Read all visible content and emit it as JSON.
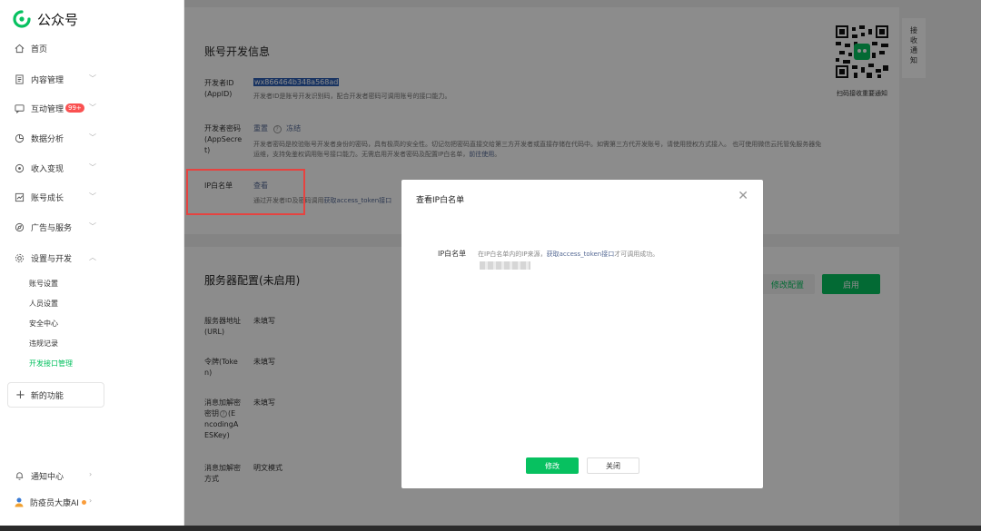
{
  "app": {
    "title": "公众号",
    "brand_color": "#07c160"
  },
  "sidebar": {
    "items": [
      {
        "label": "首页",
        "icon": "home-icon"
      },
      {
        "label": "内容管理",
        "icon": "document-icon"
      },
      {
        "label": "互动管理",
        "icon": "message-icon",
        "badge": "99+"
      },
      {
        "label": "数据分析",
        "icon": "chart-icon"
      },
      {
        "label": "收入变现",
        "icon": "coin-icon"
      },
      {
        "label": "账号成长",
        "icon": "growth-icon"
      },
      {
        "label": "广告与服务",
        "icon": "compass-icon"
      },
      {
        "label": "设置与开发",
        "icon": "gear-icon"
      }
    ],
    "sub_items": [
      "账号设置",
      "人员设置",
      "安全中心",
      "违规记录",
      "开发接口管理"
    ],
    "new_func": "新的功能",
    "notify": "通知中心",
    "user": "防疫员大康AI"
  },
  "dev_info": {
    "title": "账号开发信息",
    "appid_label1": "开发者ID",
    "appid_label2": "(AppID)",
    "appid_value": "wx866464b348a568ad",
    "appid_desc": "开发者ID是账号开发识别码，配合开发者密码可调用账号的接口能力。",
    "secret_label1": "开发者密码",
    "secret_label2": "(AppSecre",
    "secret_label3": "t)",
    "secret_reset": "重置",
    "secret_freeze": "冻结",
    "secret_desc1": "开发者密码是校验账号开发者身份的密码，具有极高的安全性。切记勿把密码直接交给第三方开发者或直接存储在代码中。如需第三方代开发账号，请使用授权方式接入。 也可使用微信云托管免服务器免",
    "secret_desc2_pre": "运维，支持免鉴权调用账号接口能力。无需启用开发者密码及配置IP白名单，",
    "secret_desc2_link": "前往使用",
    "secret_desc2_post": "。",
    "ip_label": "IP白名单",
    "ip_view": "查看",
    "ip_desc_pre": "通过开发者ID及密码调用",
    "ip_desc_link": "获取access_token接口"
  },
  "qr": {
    "text": "扫码接收重要通知"
  },
  "notify_tab": [
    "接",
    "收",
    "通",
    "知"
  ],
  "server": {
    "title": "服务器配置(未启用)",
    "edit_btn": "修改配置",
    "enable_btn": "启用",
    "url_label1": "服务器地址",
    "url_label2": "(URL)",
    "url_val": "未填写",
    "token_label1": "令牌(Toke",
    "token_label2": "n)",
    "token_val": "未填写",
    "key_label1": "消息加解密",
    "key_label2": "密钥",
    "key_label3": "(E",
    "key_label4": "ncodingA",
    "key_label5": "ESKey)",
    "key_val": "未填写",
    "mode_label1": "消息加解密",
    "mode_label2": "方式",
    "mode_val": "明文模式"
  },
  "dialog": {
    "title": "查看IP白名单",
    "label": "IP白名单",
    "desc_pre": "在IP白名单内的IP来源，",
    "desc_link": "获取access_token接口",
    "desc_post": "才可调用成功。",
    "ok": "修改",
    "close": "关闭"
  }
}
